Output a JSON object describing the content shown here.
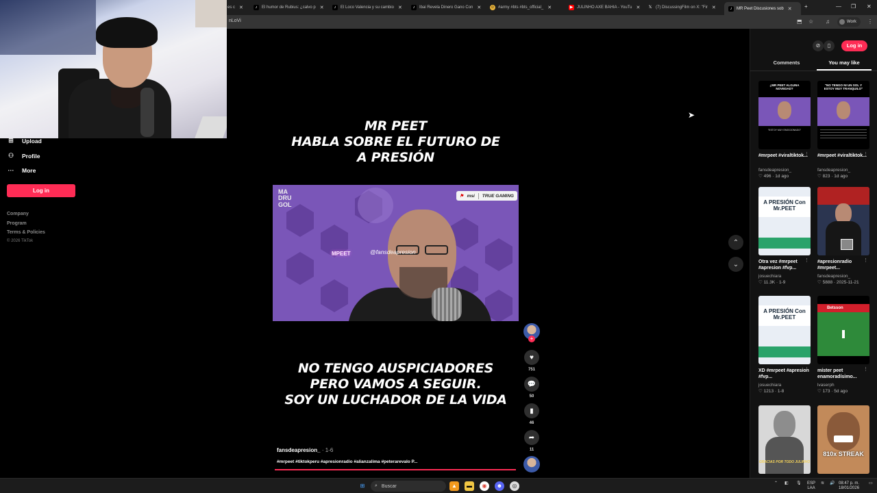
{
  "browser": {
    "tabs": [
      {
        "label": "es c",
        "favicon": "tiktok-icon"
      },
      {
        "label": "El humor de Rubius: ¿calvo p",
        "favicon": "tiktok-icon"
      },
      {
        "label": "El Loco Valencia y su cambio",
        "favicon": "tiktok-icon"
      },
      {
        "label": "Ibai Revela Dinero Gano Con",
        "favicon": "tiktok-icon"
      },
      {
        "label": "#army #bts #bts_official_",
        "favicon": "emoji-icon"
      },
      {
        "label": "JULINHO AXE BAHIA - YouTu",
        "favicon": "youtube-icon"
      },
      {
        "label": "(7) DiscussingFilm on X: \"Fir",
        "favicon": "x-icon"
      },
      {
        "label": "MR Peet Discusiones sob",
        "favicon": "tiktok-icon"
      }
    ],
    "url_fragment": "nLoVi",
    "profile_label": "Work"
  },
  "sidebar": {
    "items": [
      {
        "label": "Upload",
        "icon": "plus-square-icon"
      },
      {
        "label": "Profile",
        "icon": "person-icon"
      },
      {
        "label": "More",
        "icon": "dots-icon"
      }
    ],
    "login_label": "Log in",
    "footer_links": [
      "Company",
      "Program",
      "Terms & Policies"
    ],
    "copyright": "© 2026 TikTok"
  },
  "video": {
    "caption_top": [
      "MR PEET",
      "HABLA SOBRE EL FUTURO DE",
      "A PRESIÓN"
    ],
    "caption_bottom": [
      "NO TENGO AUSPICIADORES",
      "PERO VAMOS A SEGUIR.",
      "SOY UN LUCHADOR DE LA VIDA"
    ],
    "frame": {
      "brand_left": "msi",
      "brand_right": "TRUE GAMING",
      "channel_logo": [
        "MA",
        "DRU",
        "GOL"
      ],
      "watermark": "@fansdeapresion",
      "neon_sign": "MPEET"
    },
    "author": "fansdeapresion_",
    "date": "1-6",
    "hashtags": "#mrpeet #tiktokperu #apresionradio #alianzalima #peterarevalo P...",
    "progress_fraction": 1.0
  },
  "actions": {
    "likes": "751",
    "comments": "50",
    "saves": "46",
    "shares": "11"
  },
  "right_panel": {
    "login_label": "Log in",
    "tabs": [
      "Comments",
      "You may like"
    ],
    "active_tab": "You may like",
    "cards": [
      {
        "title": "#mrpeet #viraltiktok...",
        "author": "fansdeapresion_",
        "likes": "496",
        "date": "1d ago",
        "thumb_text": "¿MR PEET ALGUNA NOVEDAD?",
        "thumb_bottom": "\"ESTOY MUY EMOCIONADO\""
      },
      {
        "title": "#mrpeet #viraltiktok...",
        "author": "fansdeapresion_",
        "likes": "823",
        "date": "1d ago",
        "thumb_text": "\"NO TENGO NI UN SOL Y ESTOY MUY TRANQUILO\"",
        "thumb_bottom": ""
      },
      {
        "title": "Otra vez #mrpeet #apresion #fvp...",
        "author": "josuechiara",
        "likes": "11.3K",
        "date": "1-9",
        "thumb_text": "A PRESIÓN Con Mr.PEET",
        "thumb_bottom": ""
      },
      {
        "title": "#apresionradio #mrpeet...",
        "author": "fansdeapresion_",
        "likes": "5888",
        "date": "2025-11-21",
        "thumb_text": "",
        "thumb_bottom": ""
      },
      {
        "title": "XD #mrpeet #apresion #fvp...",
        "author": "josuechiara",
        "likes": "1213",
        "date": "1-8",
        "thumb_text": "A PRESIÓN Con Mr.PEET",
        "thumb_bottom": ""
      },
      {
        "title": "míster peet enamoradísimo...",
        "author": "lvaserph",
        "likes": "173",
        "date": "5d ago",
        "thumb_text": "Betsson",
        "thumb_bottom": ""
      },
      {
        "title": "",
        "author": "",
        "likes": "",
        "date": "",
        "thumb_text": "",
        "thumb_bottom": "GRACIAS POR TODO JULINHO"
      },
      {
        "title": "",
        "author": "",
        "likes": "",
        "date": "",
        "thumb_text": "",
        "thumb_bottom": "810x STREAK"
      }
    ]
  },
  "taskbar": {
    "search_label": "Buscar",
    "lang": [
      "ESP",
      "LAA"
    ],
    "time": "08:47 p. m.",
    "date": "18/01/2026"
  },
  "colors": {
    "accent": "#fe2c55",
    "panel_bg": "#121212",
    "frame_purple": "#7a56b8"
  }
}
